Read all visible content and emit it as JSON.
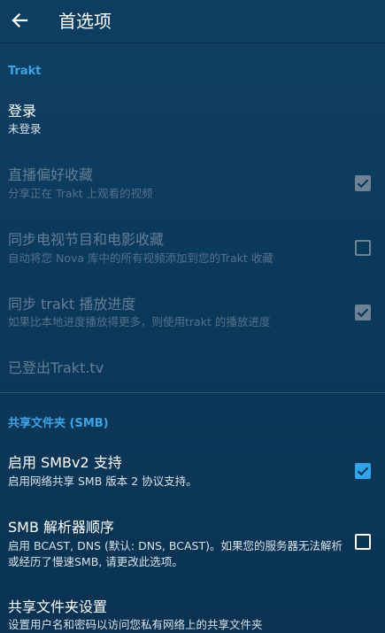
{
  "header": {
    "title": "首选项"
  },
  "trakt": {
    "section_title": "Trakt",
    "login": {
      "title": "登录",
      "subtitle": "未登录"
    },
    "live_favorites": {
      "title": "直播偏好收藏",
      "subtitle": "分享正在 Trakt 上观看的视频",
      "checked": true,
      "enabled": false
    },
    "sync_tv_movie": {
      "title": "同步电视节目和电影收藏",
      "subtitle": "自动将您 Nova 库中的所有视频添加到您的Trakt 收藏",
      "checked": false,
      "enabled": false
    },
    "sync_progress": {
      "title": "同步 trakt 播放进度",
      "subtitle": "如果比本地进度播放得更多，则使用trakt 的播放进度",
      "checked": true,
      "enabled": false
    },
    "logged_out": {
      "title": "已登出Trakt.tv"
    }
  },
  "smb": {
    "section_title": "共享文件夹 (SMB)",
    "smbv2": {
      "title": "启用 SMBv2 支持",
      "subtitle": "启用网络共享 SMB 版本 2 协议支持。",
      "checked": true,
      "enabled": true
    },
    "resolver_order": {
      "title": "SMB 解析器顺序",
      "subtitle": "启用 BCAST, DNS (默认: DNS, BCAST)。如果您的服务器无法解析或经历了慢速SMB, 请更改此选项。",
      "checked": false,
      "enabled": true
    },
    "shared_settings": {
      "title": "共享文件夹设置",
      "subtitle": "设置用户名和密码以访问您私有网络上的共享文件夹"
    }
  },
  "colors": {
    "accent": "#33a4e8",
    "section_header": "#3fa3e6",
    "background": "#0c3a5c"
  }
}
